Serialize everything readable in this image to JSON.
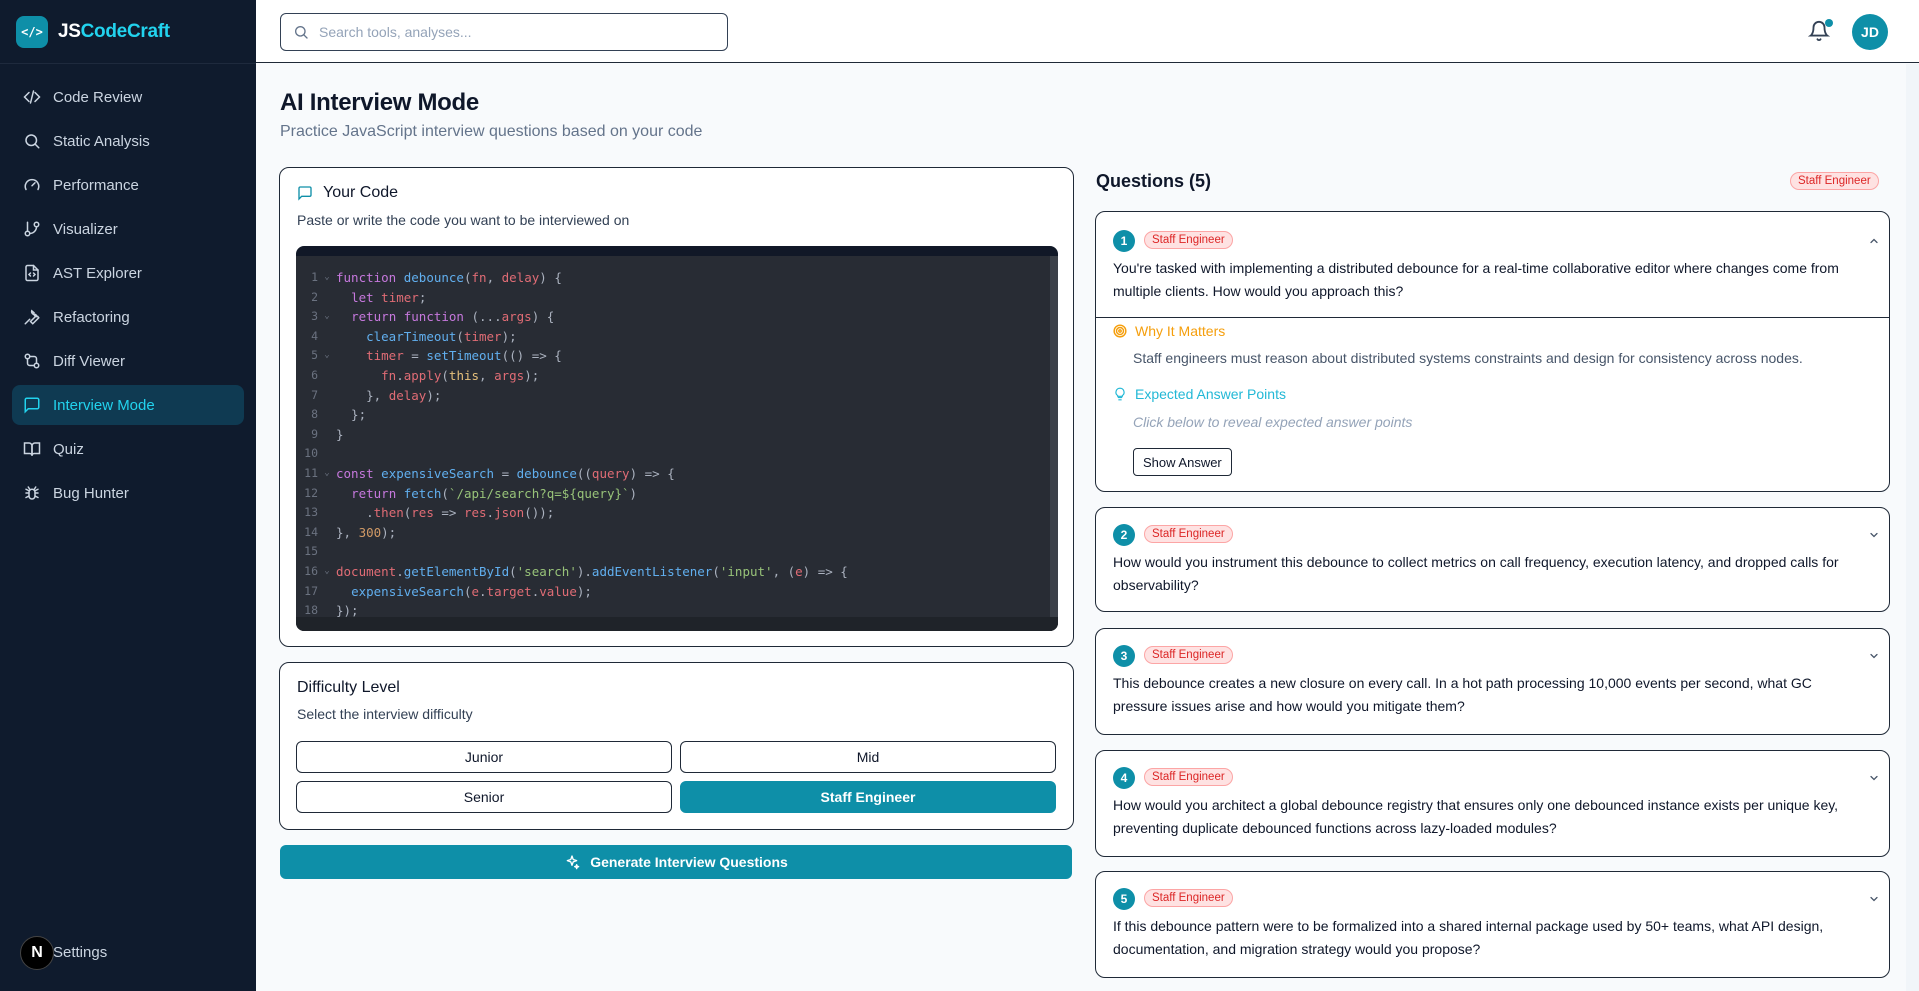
{
  "brand": {
    "prefix": "JS",
    "suffix": "CodeCraft",
    "logo_glyph": "</>"
  },
  "sidebar": {
    "items": [
      {
        "label": "Code Review",
        "icon": "code-icon",
        "active": false
      },
      {
        "label": "Static Analysis",
        "icon": "search-icon",
        "active": false
      },
      {
        "label": "Performance",
        "icon": "gauge-icon",
        "active": false
      },
      {
        "label": "Visualizer",
        "icon": "git-branch-icon",
        "active": false
      },
      {
        "label": "AST Explorer",
        "icon": "file-code-icon",
        "active": false
      },
      {
        "label": "Refactoring",
        "icon": "wrench-icon",
        "active": false
      },
      {
        "label": "Diff Viewer",
        "icon": "git-compare-icon",
        "active": false
      },
      {
        "label": "Interview Mode",
        "icon": "message-square-icon",
        "active": true
      },
      {
        "label": "Quiz",
        "icon": "book-icon",
        "active": false
      },
      {
        "label": "Bug Hunter",
        "icon": "bug-icon",
        "active": false
      }
    ],
    "settings_label": "Settings",
    "settings_badge": "N"
  },
  "header": {
    "search_placeholder": "Search tools, analyses...",
    "avatar_initials": "JD"
  },
  "page": {
    "title": "AI Interview Mode",
    "subtitle": "Practice JavaScript interview questions based on your code"
  },
  "code_card": {
    "title": "Your Code",
    "description": "Paste or write the code you want to be interviewed on",
    "lines": [
      "function debounce(fn, delay) {",
      "  let timer;",
      "  return function (...args) {",
      "    clearTimeout(timer);",
      "    timer = setTimeout(() => {",
      "      fn.apply(this, args);",
      "    }, delay);",
      "  };",
      "}",
      "",
      "const expensiveSearch = debounce((query) => {",
      "  return fetch(`/api/search?q=${query}`)",
      "    .then(res => res.json());",
      "}, 300);",
      "",
      "document.getElementById('search').addEventListener('input', (e) => {",
      "  expensiveSearch(e.target.value);",
      "});"
    ]
  },
  "difficulty": {
    "title": "Difficulty Level",
    "description": "Select the interview difficulty",
    "options": [
      "Junior",
      "Mid",
      "Senior",
      "Staff Engineer"
    ],
    "selected": "Staff Engineer"
  },
  "generate_label": "Generate Interview Questions",
  "questions": {
    "heading": "Questions (5)",
    "level_badge": "Staff Engineer",
    "items": [
      {
        "number": "1",
        "badge": "Staff Engineer",
        "text": "You're tasked with implementing a distributed debounce for a real-time collaborative editor where changes come from multiple clients. How would you approach this?",
        "expanded": true,
        "why_title": "Why It Matters",
        "why_text": "Staff engineers must reason about distributed systems constraints and design for consistency across nodes.",
        "expected_title": "Expected Answer Points",
        "expected_text": "Click below to reveal expected answer points",
        "show_answer_label": "Show Answer"
      },
      {
        "number": "2",
        "badge": "Staff Engineer",
        "text": "How would you instrument this debounce to collect metrics on call frequency, execution latency, and dropped calls for observability?",
        "expanded": false
      },
      {
        "number": "3",
        "badge": "Staff Engineer",
        "text": "This debounce creates a new closure on every call. In a hot path processing 10,000 events per second, what GC pressure issues arise and how would you mitigate them?",
        "expanded": false
      },
      {
        "number": "4",
        "badge": "Staff Engineer",
        "text": "How would you architect a global debounce registry that ensures only one debounced instance exists per unique key, preventing duplicate debounced functions across lazy-loaded modules?",
        "expanded": false
      },
      {
        "number": "5",
        "badge": "Staff Engineer",
        "text": "If this debounce pattern were to be formalized into a shared internal package used by 50+ teams, what API design, documentation, and migration strategy would you propose?",
        "expanded": false
      }
    ]
  },
  "colors": {
    "accent": "#0e8fa8",
    "sidebar_bg": "#0f1b2d",
    "badge_red": "#dc2626"
  }
}
